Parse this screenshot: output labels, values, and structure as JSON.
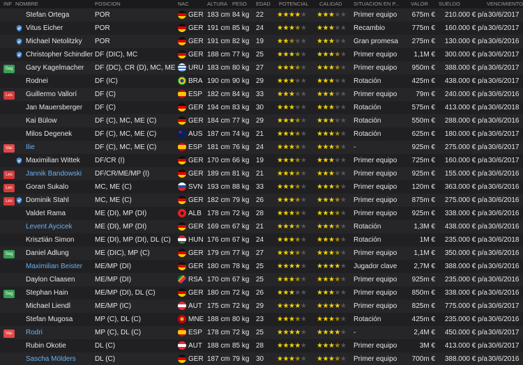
{
  "columns": {
    "inf": "INF",
    "nombre": "NOMBRE",
    "posicion": "POSICION",
    "nac": "NAC",
    "altura": "ALTURA",
    "peso": "PESO",
    "edad": "EDAD",
    "potencial": "POTENCIAL",
    "calidad": "CALIDAD",
    "situacion": "SITUACION EN P...",
    "valor": "VALOR",
    "sueldo": "SUELDO",
    "vencimiento": "VENCIMIENTO"
  },
  "colors": {
    "link": "#6ab0f0",
    "star": "#f3d200"
  },
  "players": [
    {
      "inf": "",
      "icon": false,
      "name": "Stefan Ortega",
      "link": false,
      "pos": "POR",
      "nac": "GER",
      "alt": "183 cm",
      "peso": "84 kg",
      "edad": "22",
      "pot": 4,
      "cal": 3,
      "sit": "Primer equipo",
      "val": "675m €",
      "sueldo": "210.000 € p/a",
      "venc": "30/6/2017"
    },
    {
      "inf": "",
      "icon": true,
      "name": "Vitus Eicher",
      "link": false,
      "pos": "POR",
      "nac": "GER",
      "alt": "191 cm",
      "peso": "85 kg",
      "edad": "24",
      "pot": 3.5,
      "cal": 3,
      "sit": "Recambio",
      "val": "775m €",
      "sueldo": "160.000 € p/a",
      "venc": "30/6/2017"
    },
    {
      "inf": "",
      "icon": true,
      "name": "Michael Netolitzky",
      "link": false,
      "pos": "POR",
      "nac": "GER",
      "alt": "191 cm",
      "peso": "82 kg",
      "edad": "19",
      "pot": 2.5,
      "cal": 3,
      "sit": "Gran promesa",
      "val": "275m €",
      "sueldo": "130.000 € p/a",
      "venc": "30/6/2016"
    },
    {
      "inf": "",
      "icon": true,
      "name": "Christopher Schindler",
      "link": false,
      "pos": "DF (DIC), MC",
      "nac": "GER",
      "alt": "188 cm",
      "peso": "77 kg",
      "edad": "25",
      "pot": 3.5,
      "cal": 3.5,
      "sit": "Primer equipo",
      "val": "1,1M €",
      "sueldo": "300.000 € p/a",
      "venc": "30/6/2017"
    },
    {
      "inf": "Seg",
      "icon": false,
      "name": "Gary Kagelmacher",
      "link": false,
      "pos": "DF (DC), CR (D), MC, ME (C)",
      "nac": "URU",
      "alt": "183 cm",
      "peso": "80 kg",
      "edad": "27",
      "pot": 3.5,
      "cal": 3.5,
      "sit": "Primer equipo",
      "val": "950m €",
      "sueldo": "388.000 € p/a",
      "venc": "30/6/2017"
    },
    {
      "inf": "",
      "icon": false,
      "name": "Rodnei",
      "link": false,
      "pos": "DF (IC)",
      "nac": "BRA",
      "alt": "190 cm",
      "peso": "90 kg",
      "edad": "29",
      "pot": 3,
      "cal": 3,
      "sit": "Rotación",
      "val": "425m €",
      "sueldo": "438.000 € p/a",
      "venc": "30/6/2017"
    },
    {
      "inf": "Les",
      "icon": false,
      "name": "Guillermo Vallorí",
      "link": false,
      "pos": "DF (C)",
      "nac": "ESP",
      "alt": "182 cm",
      "peso": "84 kg",
      "edad": "33",
      "pot": 3,
      "cal": 3,
      "sit": "Primer equipo",
      "val": "79m €",
      "sueldo": "240.000 € p/a",
      "venc": "30/6/2016"
    },
    {
      "inf": "",
      "icon": false,
      "name": "Jan Mauersberger",
      "link": false,
      "pos": "DF (C)",
      "nac": "GER",
      "alt": "194 cm",
      "peso": "83 kg",
      "edad": "30",
      "pot": 3,
      "cal": 3,
      "sit": "Rotación",
      "val": "575m €",
      "sueldo": "413.000 € p/a",
      "venc": "30/6/2018"
    },
    {
      "inf": "",
      "icon": false,
      "name": "Kai Bülow",
      "link": false,
      "pos": "DF (C), MC, ME (C)",
      "nac": "GER",
      "alt": "184 cm",
      "peso": "77 kg",
      "edad": "29",
      "pot": 3.5,
      "cal": 3,
      "sit": "Rotación",
      "val": "550m €",
      "sueldo": "288.000 € p/a",
      "venc": "30/6/2016"
    },
    {
      "inf": "",
      "icon": false,
      "name": "Milos Degenek",
      "link": false,
      "pos": "DF (C), MC, ME (C)",
      "nac": "AUS",
      "alt": "187 cm",
      "peso": "74 kg",
      "edad": "21",
      "pot": 3.5,
      "cal": 3.5,
      "sit": "Rotación",
      "val": "625m €",
      "sueldo": "180.000 € p/a",
      "venc": "30/6/2017"
    },
    {
      "inf": "Vac",
      "icon": false,
      "name": "Ilie",
      "link": true,
      "pos": "DF (C), MC, ME (C)",
      "nac": "ESP",
      "alt": "181 cm",
      "peso": "76 kg",
      "edad": "24",
      "pot": 3.5,
      "cal": 3.5,
      "sit": "-",
      "val": "925m €",
      "sueldo": "275.000 € p/a",
      "venc": "30/6/2017"
    },
    {
      "inf": "",
      "icon": true,
      "name": "Maximilian Wittek",
      "link": false,
      "pos": "DF/CR (I)",
      "nac": "GER",
      "alt": "170 cm",
      "peso": "66 kg",
      "edad": "19",
      "pot": 3.5,
      "cal": 3,
      "sit": "Primer equipo",
      "val": "725m €",
      "sueldo": "160.000 € p/a",
      "venc": "30/6/2017"
    },
    {
      "inf": "Les",
      "icon": false,
      "name": "Jannik Bandowski",
      "link": true,
      "pos": "DF/CR/ME/MP (I)",
      "nac": "GER",
      "alt": "189 cm",
      "peso": "81 kg",
      "edad": "21",
      "pot": 3.5,
      "cal": 3,
      "sit": "Primer equipo",
      "val": "925m €",
      "sueldo": "155.000 € p/a",
      "venc": "30/6/2016"
    },
    {
      "inf": "Les",
      "icon": false,
      "name": "Goran Sukalo",
      "link": false,
      "pos": "MC, ME (C)",
      "nac": "SVN",
      "alt": "193 cm",
      "peso": "88 kg",
      "edad": "33",
      "pot": 3.5,
      "cal": 3.5,
      "sit": "Primer equipo",
      "val": "120m €",
      "sueldo": "363.000 € p/a",
      "venc": "30/6/2016"
    },
    {
      "inf": "Les",
      "icon": true,
      "name": "Dominik Stahl",
      "link": false,
      "pos": "MC, ME (C)",
      "nac": "GER",
      "alt": "182 cm",
      "peso": "79 kg",
      "edad": "26",
      "pot": 3.5,
      "cal": 3.5,
      "sit": "Primer equipo",
      "val": "875m €",
      "sueldo": "275.000 € p/a",
      "venc": "30/6/2016"
    },
    {
      "inf": "",
      "icon": false,
      "name": "Valdet Rama",
      "link": false,
      "pos": "ME (DI), MP (DI)",
      "nac": "ALB",
      "alt": "178 cm",
      "peso": "72 kg",
      "edad": "28",
      "pot": 3.5,
      "cal": 3.5,
      "sit": "Primer equipo",
      "val": "925m €",
      "sueldo": "338.000 € p/a",
      "venc": "30/6/2016"
    },
    {
      "inf": "",
      "icon": false,
      "name": "Levent Aycicek",
      "link": true,
      "pos": "ME (DI), MP (DI)",
      "nac": "GER",
      "alt": "169 cm",
      "peso": "67 kg",
      "edad": "21",
      "pot": 3.5,
      "cal": 3.5,
      "sit": "Rotación",
      "val": "1,3M €",
      "sueldo": "438.000 € p/a",
      "venc": "30/6/2016"
    },
    {
      "inf": "",
      "icon": false,
      "name": "Krisztián Simon",
      "link": false,
      "pos": "ME (DI), MP (DI), DL (C)",
      "nac": "HUN",
      "alt": "176 cm",
      "peso": "67 kg",
      "edad": "24",
      "pot": 3.5,
      "cal": 3.5,
      "sit": "Rotación",
      "val": "1M €",
      "sueldo": "235.000 € p/a",
      "venc": "30/6/2018"
    },
    {
      "inf": "Seg",
      "icon": false,
      "name": "Daniel Adlung",
      "link": false,
      "pos": "ME (DIC), MP (C)",
      "nac": "GER",
      "alt": "179 cm",
      "peso": "77 kg",
      "edad": "27",
      "pot": 3.5,
      "cal": 3.5,
      "sit": "Primer equipo",
      "val": "1,1M €",
      "sueldo": "350.000 € p/a",
      "venc": "30/6/2016"
    },
    {
      "inf": "",
      "icon": false,
      "name": "Maximilian Beister",
      "link": true,
      "pos": "ME/MP (DI)",
      "nac": "GER",
      "alt": "180 cm",
      "peso": "78 kg",
      "edad": "25",
      "pot": 4,
      "cal": 4,
      "sit": "Jugador clave",
      "val": "2,7M €",
      "sueldo": "388.000 € p/a",
      "venc": "30/6/2016"
    },
    {
      "inf": "",
      "icon": false,
      "name": "Daylon Claasen",
      "link": false,
      "pos": "ME/MP (DI)",
      "nac": "RSA",
      "alt": "170 cm",
      "peso": "67 kg",
      "edad": "25",
      "pot": 3.5,
      "cal": 3.5,
      "sit": "Primer equipo",
      "val": "925m €",
      "sueldo": "235.000 € p/a",
      "venc": "30/6/2016"
    },
    {
      "inf": "Seg",
      "icon": false,
      "name": "Stephan Hain",
      "link": false,
      "pos": "ME/MP (DI), DL (C)",
      "nac": "GER",
      "alt": "180 cm",
      "peso": "72 kg",
      "edad": "26",
      "pot": 3,
      "cal": 3,
      "sit": "Primer equipo",
      "val": "850m €",
      "sueldo": "338.000 € p/a",
      "venc": "30/6/2016"
    },
    {
      "inf": "",
      "icon": false,
      "name": "Michael Liendl",
      "link": false,
      "pos": "ME/MP (IC)",
      "nac": "AUT",
      "alt": "175 cm",
      "peso": "72 kg",
      "edad": "29",
      "pot": 4,
      "cal": 4,
      "sit": "Primer equipo",
      "val": "825m €",
      "sueldo": "775.000 € p/a",
      "venc": "30/6/2017"
    },
    {
      "inf": "",
      "icon": false,
      "name": "Stefan Mugosa",
      "link": false,
      "pos": "MP (C), DL (C)",
      "nac": "MNE",
      "alt": "188 cm",
      "peso": "80 kg",
      "edad": "23",
      "pot": 3.5,
      "cal": 3.5,
      "sit": "Rotación",
      "val": "425m €",
      "sueldo": "235.000 € p/a",
      "venc": "30/6/2016"
    },
    {
      "inf": "Vac",
      "icon": false,
      "name": "Rodri",
      "link": true,
      "pos": "MP (C), DL (C)",
      "nac": "ESP",
      "alt": "178 cm",
      "peso": "72 kg",
      "edad": "25",
      "pot": 4,
      "cal": 4,
      "sit": "-",
      "val": "2,4M €",
      "sueldo": "450.000 € p/a",
      "venc": "30/6/2017"
    },
    {
      "inf": "",
      "icon": false,
      "name": "Rubin Okotie",
      "link": false,
      "pos": "DL (C)",
      "nac": "AUT",
      "alt": "188 cm",
      "peso": "85 kg",
      "edad": "28",
      "pot": 4,
      "cal": 3.5,
      "sit": "Primer equipo",
      "val": "3M €",
      "sueldo": "413.000 € p/a",
      "venc": "30/6/2017"
    },
    {
      "inf": "",
      "icon": false,
      "name": "Sascha Mölders",
      "link": true,
      "pos": "DL (C)",
      "nac": "GER",
      "alt": "187 cm",
      "peso": "79 kg",
      "edad": "30",
      "pot": 3.5,
      "cal": 3.5,
      "sit": "Primer equipo",
      "val": "700m €",
      "sueldo": "388.000 € p/a",
      "venc": "30/6/2016"
    }
  ]
}
